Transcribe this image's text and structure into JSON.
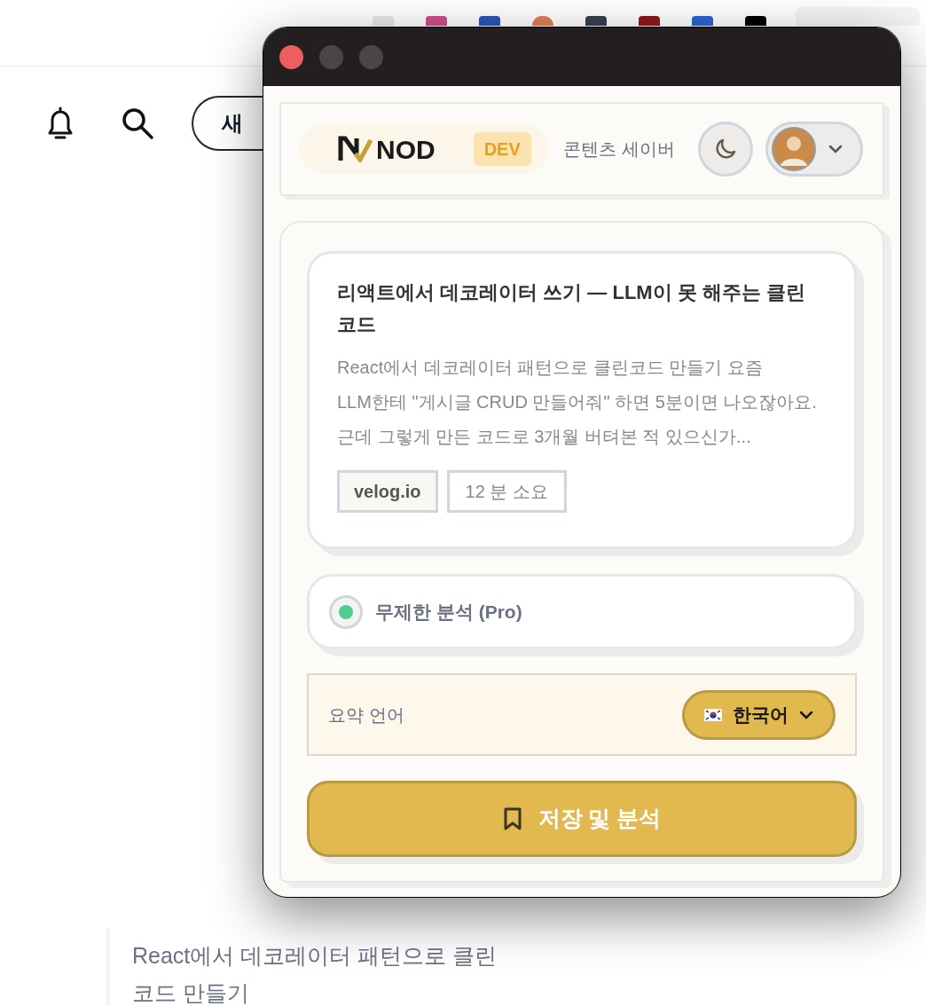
{
  "page": {
    "new_post_button": "새",
    "quote": "React에서 데코레이터 패턴으로 클린 코드 만들기"
  },
  "popup": {
    "header": {
      "logo": "NOD",
      "badge": "DEV",
      "subtitle": "콘텐츠 세이버"
    },
    "article": {
      "title": "리액트에서 데코레이터 쓰기 — LLM이 못 해주는 클린 코드",
      "excerpt": "React에서 데코레이터 패턴으로 클린코드 만들기 요즘 LLM한테 \"게시글 CRUD 만들어줘\" 하면 5분이면 나오잖아요. 근데 그렇게 만든 코드로 3개월 버텨본 적 있으신가...",
      "tags": [
        {
          "kind": "source",
          "label": "velog.io"
        },
        {
          "kind": "duration",
          "label": "12 분 소요"
        }
      ]
    },
    "pro_option": {
      "label": "무제한 분석 (Pro)",
      "on": true
    },
    "language": {
      "label": "요약 언어",
      "value": "한국어"
    },
    "save_button": "저장 및 분석"
  }
}
